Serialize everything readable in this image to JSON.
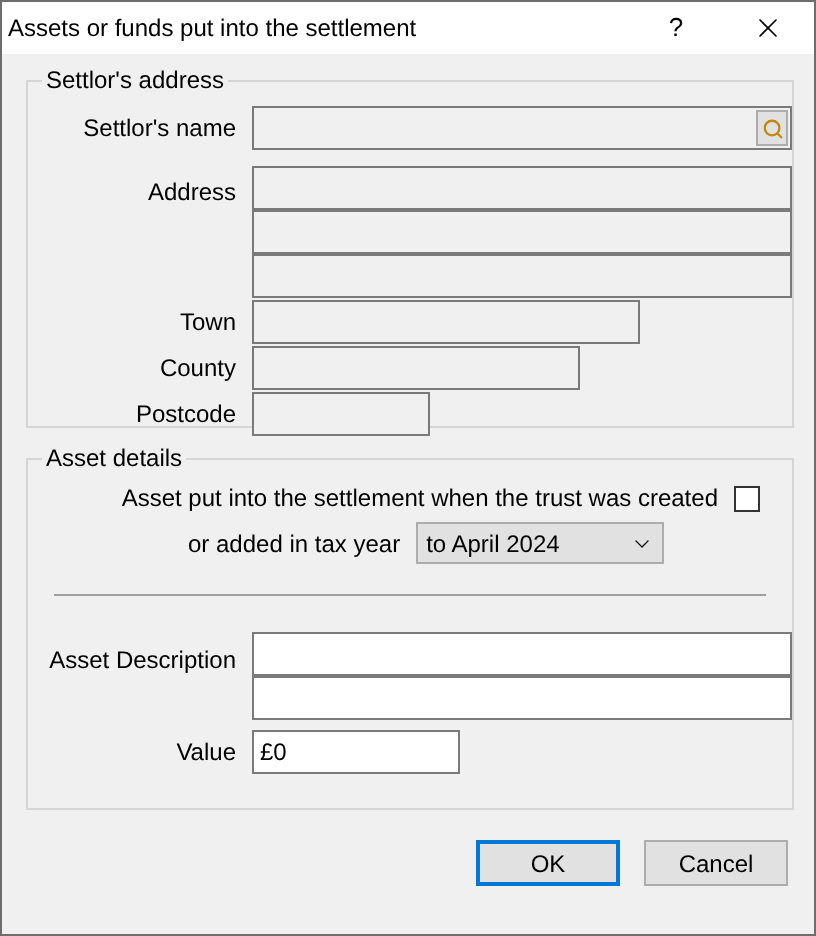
{
  "window": {
    "title": "Assets or funds put into the settlement",
    "help": "?"
  },
  "settlor_address": {
    "title": "Settlor's address",
    "name": {
      "label": "Settlor's name",
      "disabled": true
    },
    "address": {
      "label": "Address",
      "lines": [
        {
          "disabled": true
        },
        {
          "disabled": true
        },
        {
          "disabled": true
        }
      ]
    },
    "town": {
      "label": "Town",
      "disabled": true
    },
    "county": {
      "label": "County",
      "disabled": true
    },
    "postcode": {
      "label": "Postcode",
      "disabled": true
    }
  },
  "asset_details": {
    "title": "Asset details",
    "created_checkbox": {
      "label": "Asset put into the settlement when the trust was created",
      "checked": false
    },
    "tax_year": {
      "label": "or added in tax year",
      "value": "to April 2024"
    },
    "description": {
      "label": "Asset Description",
      "lines": [
        {
          "disabled": false
        },
        {
          "disabled": false
        }
      ]
    },
    "value": {
      "label": "Value",
      "value": "£0",
      "disabled": false
    }
  },
  "buttons": [
    {
      "label": "OK",
      "default": true
    },
    {
      "label": "Cancel",
      "default": false
    }
  ]
}
